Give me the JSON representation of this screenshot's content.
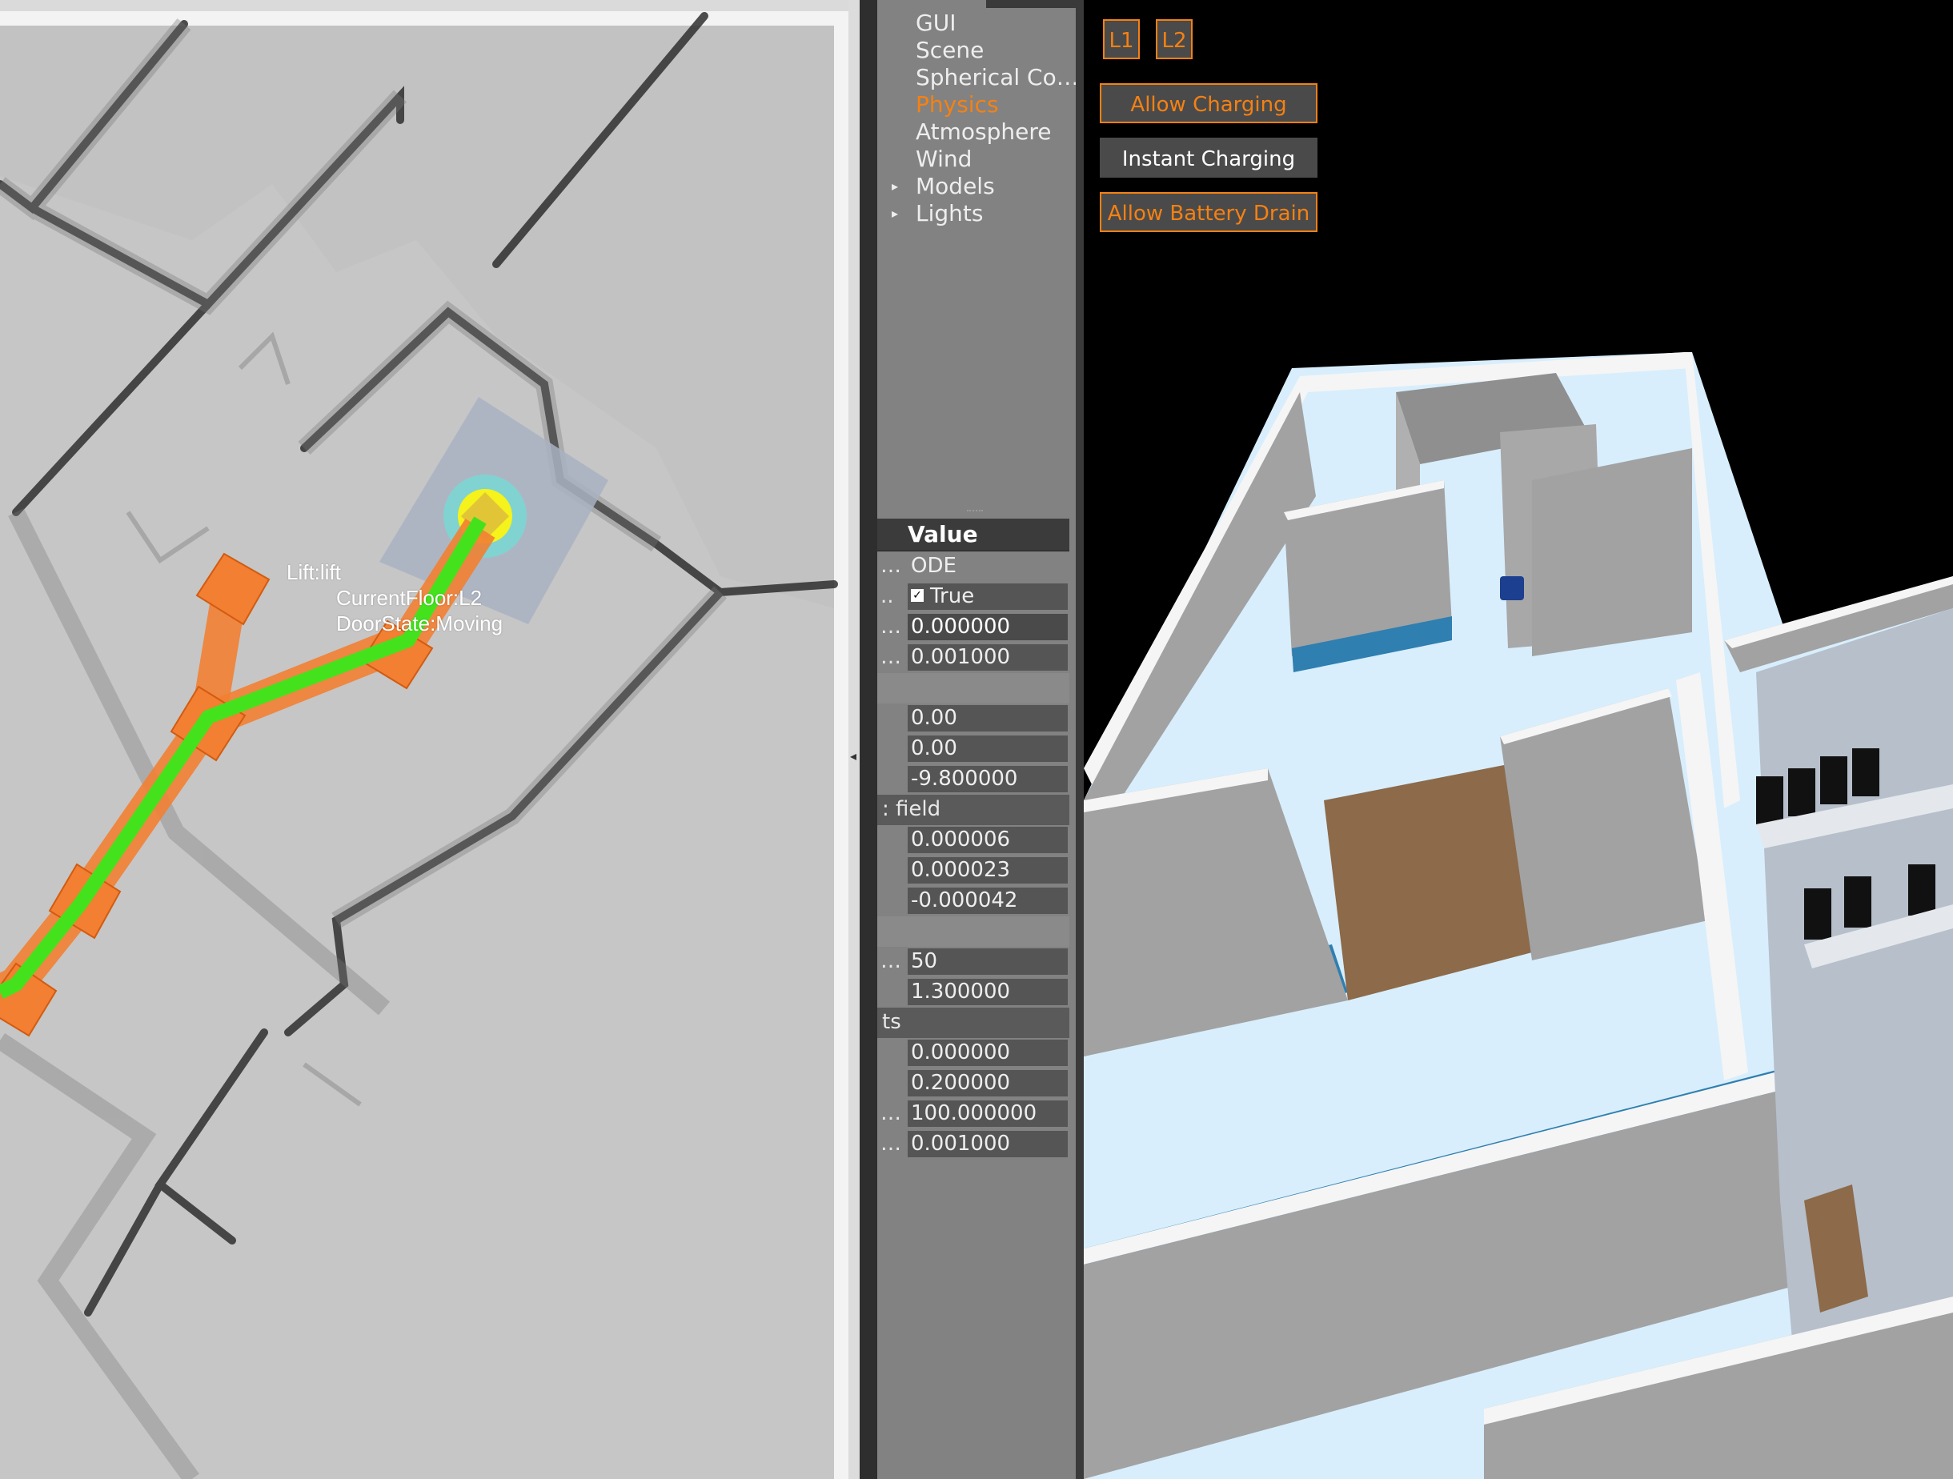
{
  "map": {
    "lift_label": "Lift:lift",
    "current_floor": "CurrentFloor:L2",
    "door_state": "DoorState:Moving",
    "colors": {
      "path_outer": "#f27f32",
      "path_inner": "#44e21d",
      "goal": "#f5f21c",
      "goal_ring": "#7cd6d4",
      "lift_box": "#a9b2c1"
    }
  },
  "world_panel": {
    "tree": [
      {
        "label": "GUI",
        "selected": false,
        "expandable": false
      },
      {
        "label": "Scene",
        "selected": false,
        "expandable": false
      },
      {
        "label": "Spherical Co…",
        "selected": false,
        "expandable": false
      },
      {
        "label": "Physics",
        "selected": true,
        "expandable": false
      },
      {
        "label": "Atmosphere",
        "selected": false,
        "expandable": false
      },
      {
        "label": "Wind",
        "selected": false,
        "expandable": false
      },
      {
        "label": "Models",
        "selected": false,
        "expandable": true
      },
      {
        "label": "Lights",
        "selected": false,
        "expandable": true
      }
    ],
    "selected_color": "#f58113",
    "table_header": "Value",
    "rows": [
      {
        "key": "…",
        "value": "ODE"
      },
      {
        "key": "..",
        "value": "True",
        "checkbox": true
      },
      {
        "key": "…",
        "value": "0.000000"
      },
      {
        "key": "…",
        "value": "0.001000"
      },
      {
        "key": "",
        "value": ""
      },
      {
        "key": "",
        "value": "0.00"
      },
      {
        "key": "",
        "value": "0.00"
      },
      {
        "key": "",
        "value": "-9.800000"
      },
      {
        "key": ": field",
        "value": ""
      },
      {
        "key": "",
        "value": "0.000006"
      },
      {
        "key": "",
        "value": "0.000023"
      },
      {
        "key": "",
        "value": "-0.000042"
      },
      {
        "key": "",
        "value": ""
      },
      {
        "key": "…",
        "value": "50"
      },
      {
        "key": "",
        "value": "1.300000"
      },
      {
        "key": "ts",
        "value": ""
      },
      {
        "key": "",
        "value": "0.000000"
      },
      {
        "key": "",
        "value": "0.200000"
      },
      {
        "key": "…",
        "value": "100.000000"
      },
      {
        "key": "…",
        "value": "0.001000"
      }
    ]
  },
  "scene": {
    "floor_buttons": [
      "L1",
      "L2"
    ],
    "allow_charging": "Allow Charging",
    "instant_charging": "Instant Charging",
    "allow_battery_drain": "Allow Battery Drain",
    "accent_color": "#f58113",
    "colors": {
      "wall": "#a2a2a2",
      "floor": "#d8eefc",
      "blue_trim": "#2f7fb0",
      "door": "#8c6a4a"
    }
  }
}
